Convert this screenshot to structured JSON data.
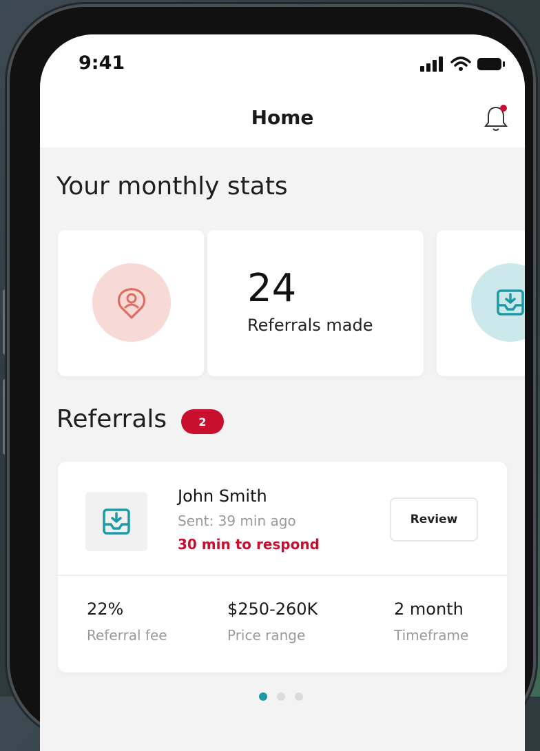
{
  "status_bar": {
    "time": "9:41"
  },
  "header": {
    "title": "Home"
  },
  "stats": {
    "section_title": "Your monthly stats",
    "cards": [
      {
        "icon": "user-pin-icon",
        "value": "24",
        "label": "Referrals made"
      },
      {
        "icon": "inbox-download-icon"
      }
    ]
  },
  "referrals": {
    "section_title": "Referrals",
    "count": "2",
    "items": [
      {
        "icon": "inbox-download-icon",
        "name": "John Smith",
        "sent": "Sent: 39 min ago",
        "deadline": "30 min to respond",
        "action_label": "Review",
        "metrics": [
          {
            "value": "22%",
            "label": "Referral fee"
          },
          {
            "value": "$250-260K",
            "label": "Price range"
          },
          {
            "value": "2 month",
            "label": "Timeframe"
          }
        ]
      }
    ]
  },
  "pagination": {
    "pages": 3,
    "active": 1
  },
  "colors": {
    "accent_red": "#c8102e",
    "accent_teal": "#1b9aa8",
    "pink_circle": "#f7d9d6",
    "teal_circle": "#cde8ea"
  }
}
